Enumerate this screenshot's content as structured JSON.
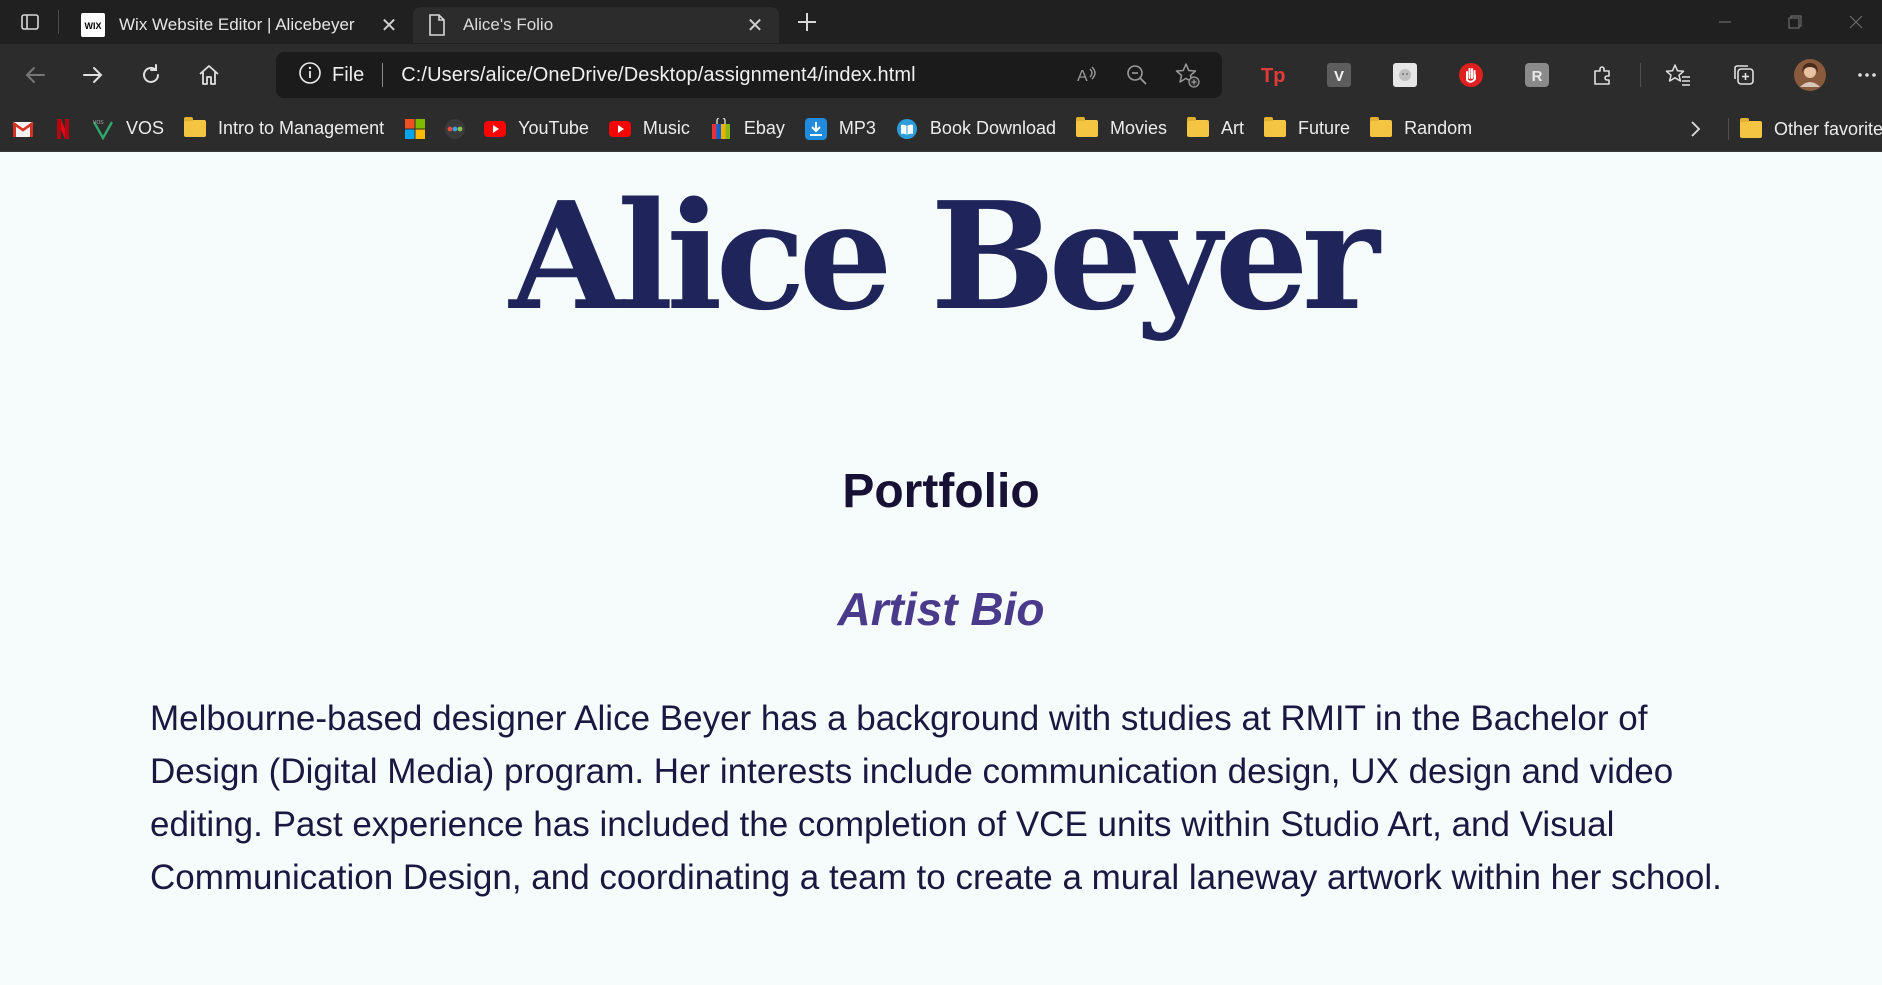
{
  "browser": {
    "tabs": [
      {
        "title": "Wix Website Editor | Alicebeyer",
        "favicon": "wix-favicon",
        "favicon_text": "WIX",
        "active": false
      },
      {
        "title": "Alice's Folio",
        "favicon": "document-icon",
        "active": true
      }
    ],
    "address_bar": {
      "site_info_label": "File",
      "url": "C:/Users/alice/OneDrive/Desktop/assignment4/index.html"
    },
    "extensions": [
      {
        "name": "tp-extension-icon",
        "text": "Tp"
      },
      {
        "name": "v-extension-icon",
        "text": "V"
      },
      {
        "name": "face-extension-icon"
      },
      {
        "name": "hand-stop-extension-icon"
      },
      {
        "name": "r-extension-icon",
        "text": "R"
      }
    ],
    "bookmarks": [
      {
        "name": "gmail-icon",
        "label": ""
      },
      {
        "name": "netflix-icon",
        "label": ""
      },
      {
        "name": "vos-icon",
        "label": "VOS"
      },
      {
        "name": "folder-icon",
        "label": "Intro to Management"
      },
      {
        "name": "microsoft-icon",
        "label": ""
      },
      {
        "name": "dots-icon",
        "label": ""
      },
      {
        "name": "youtube-icon",
        "label": "YouTube"
      },
      {
        "name": "youtube-music-icon",
        "label": "Music"
      },
      {
        "name": "ebay-icon",
        "label": "Ebay"
      },
      {
        "name": "download-icon",
        "label": "MP3"
      },
      {
        "name": "book-icon",
        "label": "Book Download"
      },
      {
        "name": "folder-icon",
        "label": "Movies"
      },
      {
        "name": "folder-icon",
        "label": "Art"
      },
      {
        "name": "folder-icon",
        "label": "Future"
      },
      {
        "name": "folder-icon",
        "label": "Random"
      }
    ],
    "other_favorites_label": "Other favorite"
  },
  "page": {
    "site_title": "Alice Beyer",
    "section_heading": "Portfolio",
    "sub_heading": "Artist Bio",
    "bio_text": "Melbourne-based designer Alice Beyer has a background with studies at RMIT in the Bachelor of Design (Digital Media) program. Her interests include communication design, UX design and video editing. Past experience has included the completion of VCE units within Studio Art, and Visual Communication Design, and coordinating a team to create a mural laneway artwork within her school."
  },
  "colors": {
    "title": "#1f245b",
    "heading": "#171135",
    "subheading": "#4a3a8c",
    "body_text": "#1a1740",
    "page_bg": "#f6fbfb"
  }
}
